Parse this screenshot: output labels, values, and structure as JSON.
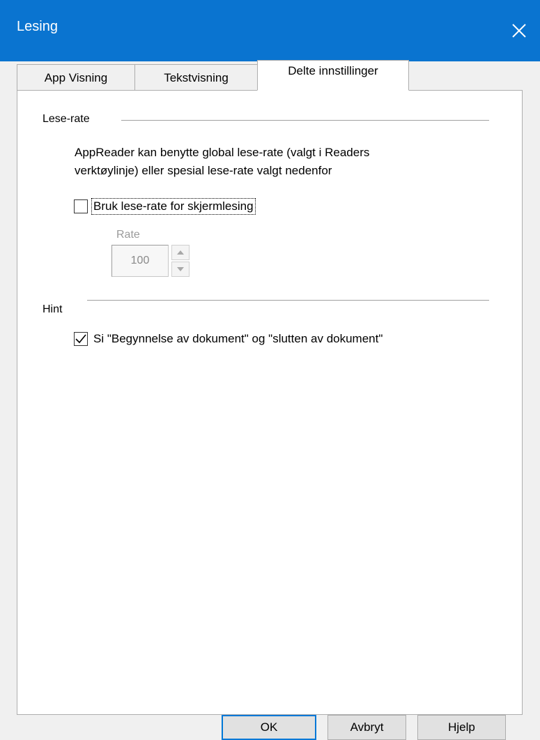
{
  "window": {
    "title": "Lesing"
  },
  "tabs": [
    {
      "label": "App Visning"
    },
    {
      "label": "Tekstvisning"
    },
    {
      "label": "Delte innstillinger",
      "active": true
    }
  ],
  "reading_rate": {
    "group_label": "Lese-rate",
    "description_line1": "AppReader kan benytte global lese-rate (valgt i Readers",
    "description_line2": "verktøylinje) eller spesial lese-rate valgt nedenfor",
    "checkbox_label": "Bruk lese-rate for skjermlesing",
    "checked": false,
    "rate_label": "Rate",
    "rate_value": "100"
  },
  "hint": {
    "group_label": "Hint",
    "checkbox_label": "Si \"Begynnelse av dokument\" og \"slutten av dokument\"",
    "checked": true
  },
  "buttons": {
    "ok": "OK",
    "cancel": "Avbryt",
    "help": "Hjelp"
  },
  "colors": {
    "titlebar": "#0a74d0",
    "default_button_border": "#0078d7"
  },
  "icons": [
    "close-icon",
    "checkmark-icon",
    "spin-up-icon",
    "spin-down-icon"
  ]
}
